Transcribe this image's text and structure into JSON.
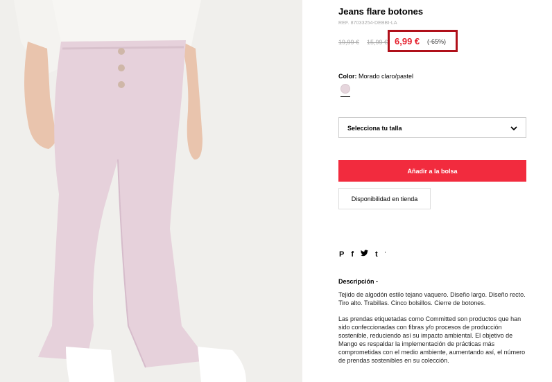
{
  "product": {
    "title": "Jeans flare botones",
    "ref": "REF. 87033254-DEBBI-LA",
    "old_price_1": "19,99 €",
    "old_price_2": "15,99 €",
    "price": "6,99 €",
    "discount": "(-65%)",
    "color_label": "Color:",
    "color_value": "Morado claro/pastel",
    "swatch_color": "#e6d6dd"
  },
  "size_select": {
    "label": "Selecciona tu talla"
  },
  "buttons": {
    "add_to_bag": "Añadir a la bolsa",
    "store_availability": "Disponibilidad en tienda"
  },
  "social": {
    "icons": [
      "pinterest-icon",
      "facebook-icon",
      "twitter-icon",
      "tumblr-icon"
    ],
    "pinterest": "P",
    "facebook": "f",
    "tumblr": "t",
    "extra": "'"
  },
  "description": {
    "title": "Descripción -",
    "p1": "Tejido de algodón estilo tejano vaquero. Diseño largo. Diseño recto. Tiro alto. Trabillas. Cinco bolsillos. Cierre de botones.",
    "p2": "Las prendas etiquetadas como Committed son productos que han sido confeccionadas con fibras y/o procesos de producción sostenible, reduciendo así su impacto ambiental. El objetivo de Mango es respaldar la implementación de prácticas más comprometidas con el medio ambiente, aumentando así, el número de prendas sostenibles en su colección."
  },
  "colors": {
    "accent_red": "#f22b3e",
    "highlight_border": "#b0101a",
    "price_red": "#e5212e"
  }
}
